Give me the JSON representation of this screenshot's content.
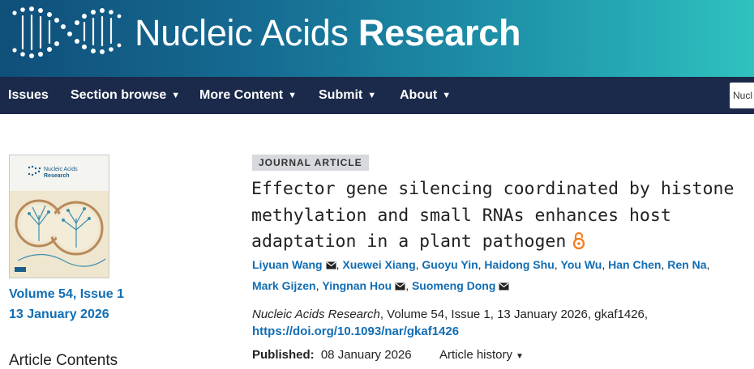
{
  "header": {
    "brand_light": "Nucleic Acids",
    "brand_bold": "Research",
    "logo_icon": "dna-helix-logo-icon",
    "gradient_colors": [
      "#0f4f7a",
      "#2fc2c0"
    ]
  },
  "nav": {
    "items": [
      {
        "label": "Issues",
        "has_caret": false
      },
      {
        "label": "Section browse",
        "has_caret": true
      },
      {
        "label": "More Content",
        "has_caret": true
      },
      {
        "label": "Submit",
        "has_caret": true
      },
      {
        "label": "About",
        "has_caret": true
      }
    ],
    "search_value": "Nucl",
    "background": "#1b2a4a"
  },
  "sidebar": {
    "cover_title_light": "Nucleic Acids",
    "cover_title_bold": "Research",
    "volume_issue": "Volume 54, Issue 1",
    "issue_date": "13 January 2026",
    "contents_heading": "Article Contents"
  },
  "article": {
    "type_badge": "JOURNAL ARTICLE",
    "title_lines": [
      "Effector gene silencing coordinated by histone",
      "methylation and small RNAs enhances host",
      "adaptation in a plant pathogen"
    ],
    "open_access_icon": "open-access-lock-icon",
    "authors": [
      {
        "name": "Liyuan Wang",
        "email": true
      },
      {
        "name": "Xuewei Xiang",
        "email": false
      },
      {
        "name": "Guoyu Yin",
        "email": false
      },
      {
        "name": "Haidong Shu",
        "email": false
      },
      {
        "name": "You Wu",
        "email": false
      },
      {
        "name": "Han Chen",
        "email": false
      },
      {
        "name": "Ren Na",
        "email": false
      },
      {
        "name": "Mark Gijzen",
        "email": false
      },
      {
        "name": "Yingnan Hou",
        "email": true
      },
      {
        "name": "Suomeng Dong",
        "email": true
      }
    ],
    "journal": "Nucleic Acids Research",
    "citation_rest": ", Volume 54, Issue 1, 13 January 2026, gkaf1426,",
    "doi": "https://doi.org/10.1093/nar/gkaf1426",
    "published_label": "Published:",
    "published_date": "08 January 2026",
    "history_label": "Article history",
    "link_color": "#116db3",
    "open_access_color": "#f58025"
  }
}
